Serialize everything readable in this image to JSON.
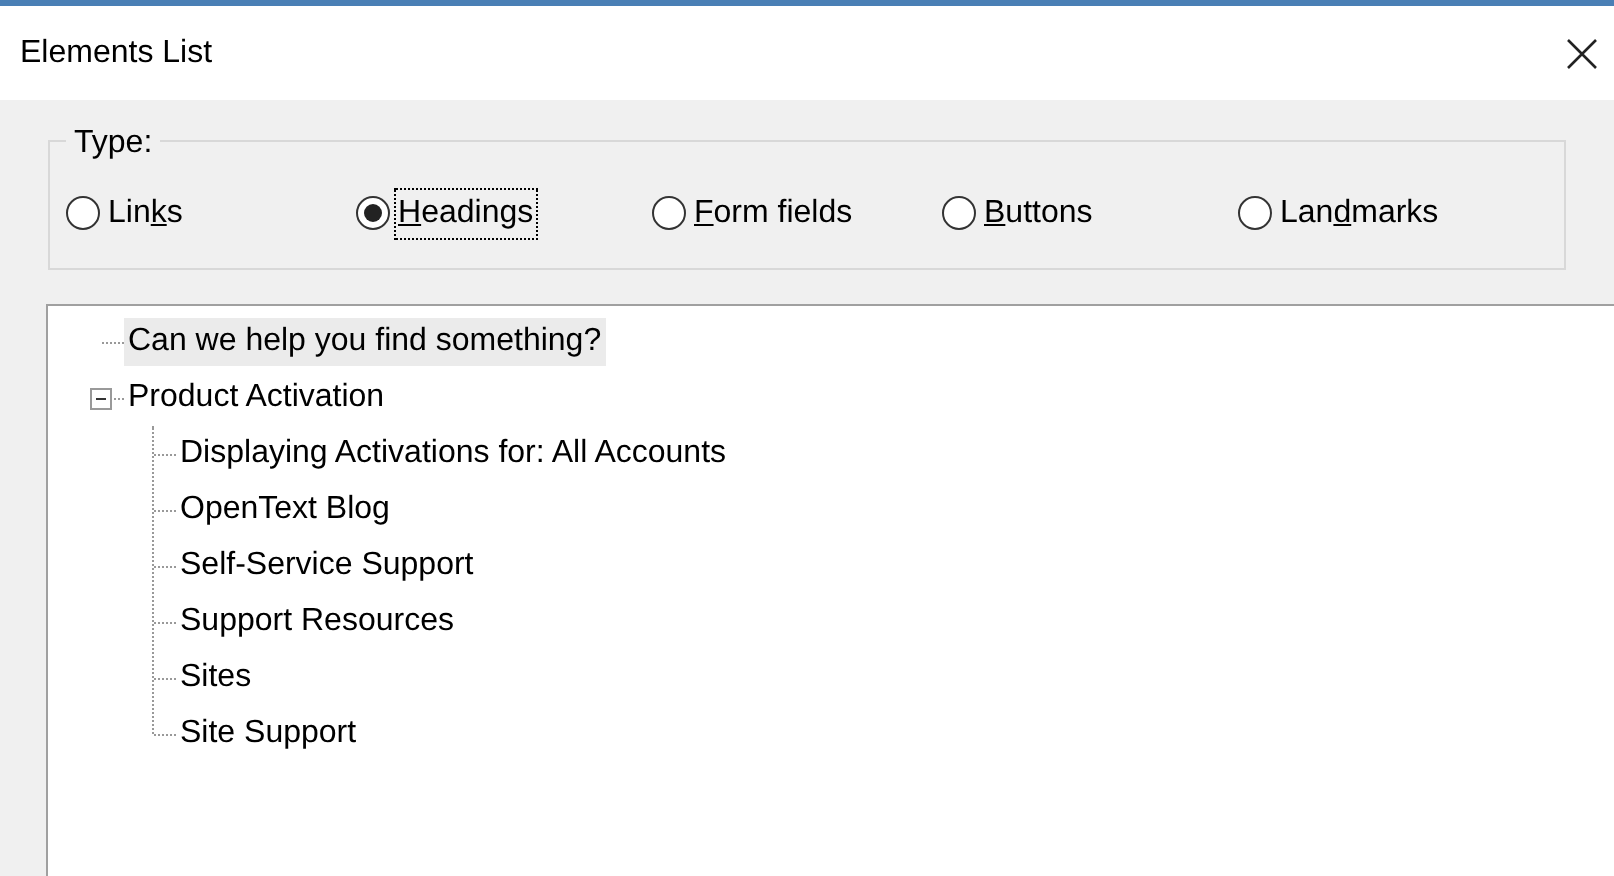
{
  "window": {
    "title": "Elements List"
  },
  "type_group": {
    "label": "Type:",
    "options": [
      {
        "label": {
          "before": "Lin",
          "access_key": "k",
          "after": "s"
        },
        "selected": false
      },
      {
        "label": {
          "access_key": "H",
          "after": "eadings"
        },
        "selected": true
      },
      {
        "label": {
          "access_key": "F",
          "after": "orm fields"
        },
        "selected": false
      },
      {
        "label": {
          "access_key": "B",
          "after": "uttons"
        },
        "selected": false
      },
      {
        "label": {
          "before": "Lan",
          "access_key": "d",
          "after": "marks"
        },
        "selected": false
      }
    ]
  },
  "tree": [
    {
      "label": "Can we help you find something?",
      "selected": true
    },
    {
      "label": "Product Activation",
      "selected": false,
      "expanded": true,
      "children": [
        {
          "label": "Displaying Activations for: All Accounts",
          "selected": false
        },
        {
          "label": "OpenText Blog",
          "selected": false
        },
        {
          "label": "Self-Service Support",
          "selected": false
        },
        {
          "label": "Support Resources",
          "selected": false
        },
        {
          "label": "Sites",
          "selected": false
        },
        {
          "label": "Site Support",
          "selected": false
        }
      ]
    }
  ]
}
